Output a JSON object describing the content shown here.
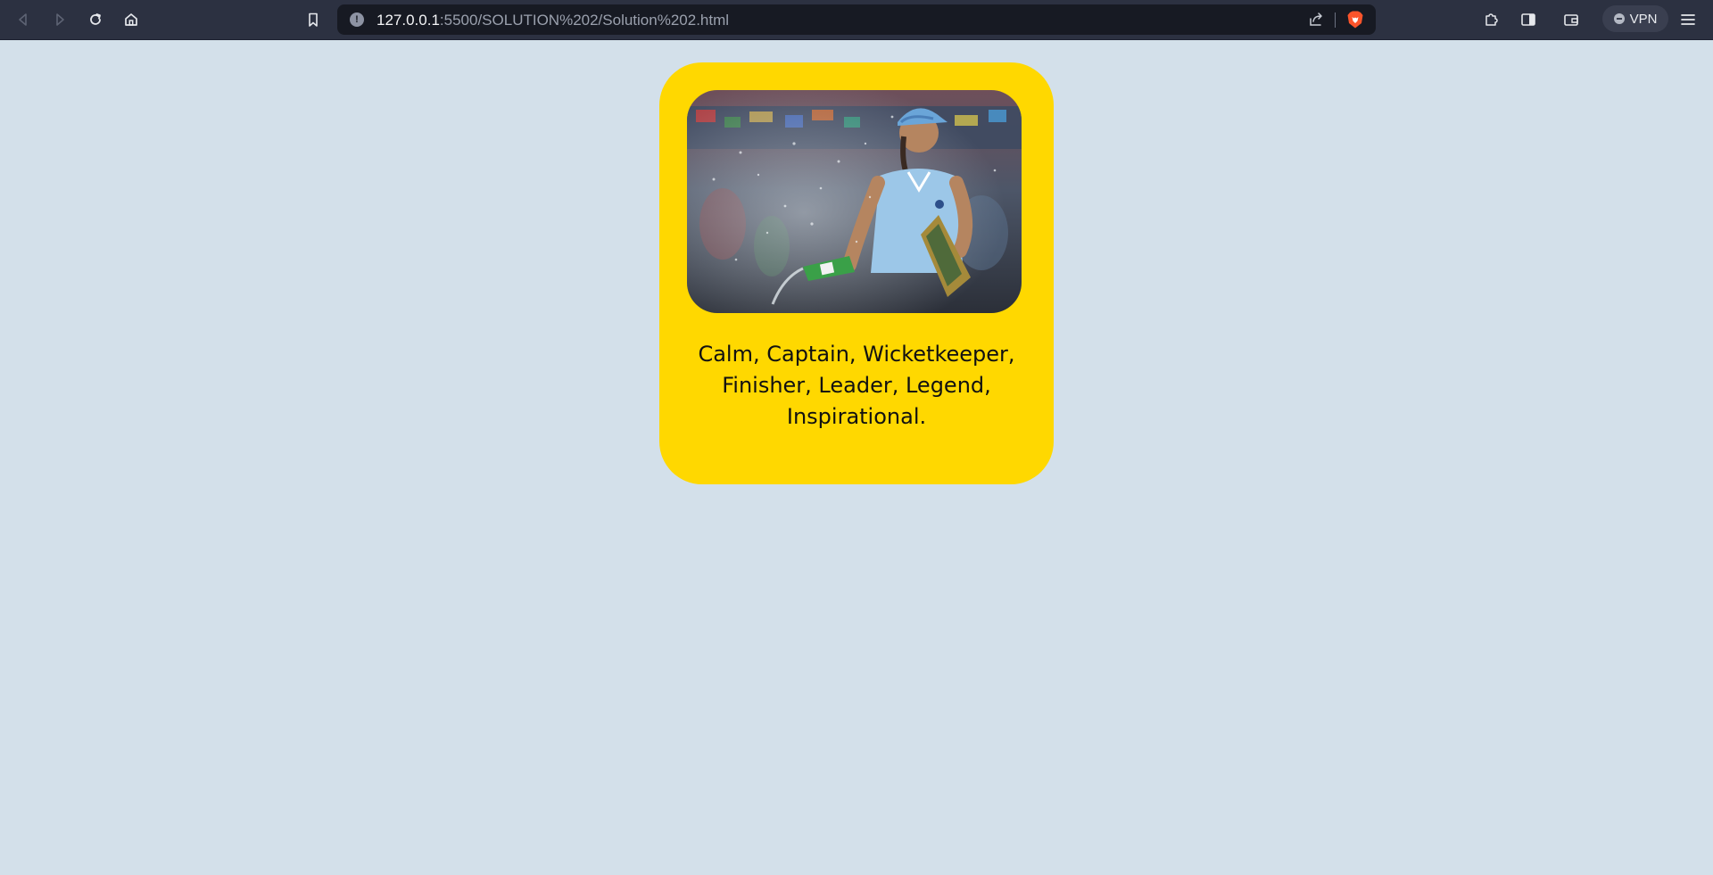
{
  "browser": {
    "url_host": "127.0.0.1",
    "url_path": ":5500/SOLUTION%202/Solution%202.html",
    "vpn_label": "VPN",
    "icons": {
      "back": "back-icon",
      "forward": "forward-icon",
      "reload": "reload-icon",
      "home": "home-icon",
      "bookmark": "bookmark-icon",
      "site_info": "site-info-icon",
      "share": "share-icon",
      "brave_shields": "brave-shield-icon",
      "extensions": "puzzle-icon",
      "sidebar": "sidebar-icon",
      "wallet": "wallet-icon",
      "menu": "hamburger-icon"
    }
  },
  "card": {
    "caption": "Calm, Captain, Wicketkeeper, Finisher, Leader, Legend, Inspirational.",
    "image": "cricketer-celebration-photo"
  },
  "colors": {
    "page_background": "#d3e0ea",
    "card_background": "#ffd800",
    "toolbar_background": "#2c3141",
    "urlbar_background": "#171a23"
  }
}
